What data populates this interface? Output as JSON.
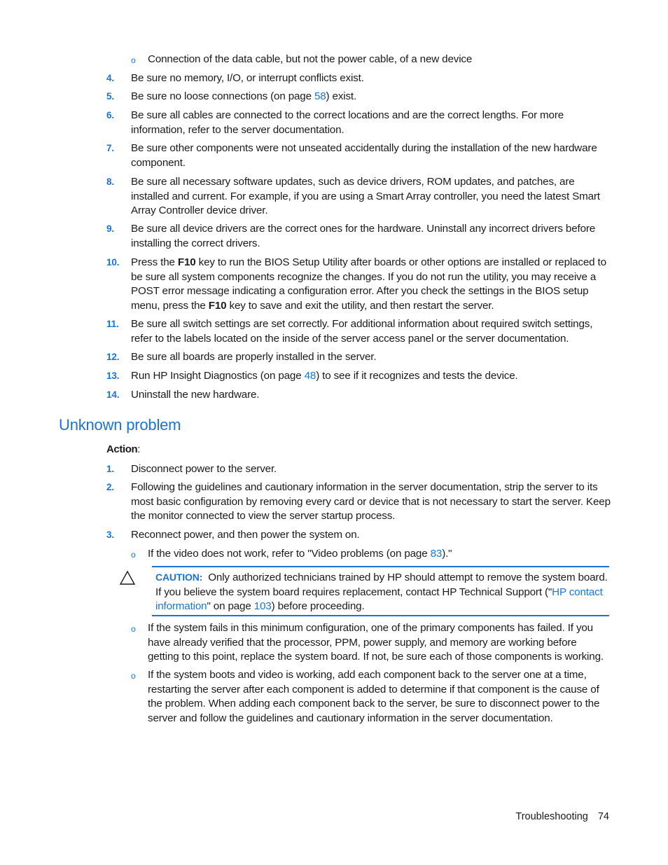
{
  "top_sub_bullet": "Connection of the data cable, but not the power cable, of a new device",
  "steps_part1": [
    {
      "num": "4.",
      "text": "Be sure no memory, I/O, or interrupt conflicts exist."
    },
    {
      "num": "5.",
      "pre": "Be sure no loose connections (on page ",
      "link": "58",
      "post": ") exist."
    },
    {
      "num": "6.",
      "text": "Be sure all cables are connected to the correct locations and are the correct lengths. For more information, refer to the server documentation."
    },
    {
      "num": "7.",
      "text": "Be sure other components were not unseated accidentally during the installation of the new hardware component."
    },
    {
      "num": "8.",
      "text": "Be sure all necessary software updates, such as device drivers, ROM updates, and patches, are installed and current. For example, if you are using a Smart Array controller, you need the latest Smart Array Controller device driver."
    },
    {
      "num": "9.",
      "text": "Be sure all device drivers are the correct ones for the hardware. Uninstall any incorrect drivers before installing the correct drivers."
    },
    {
      "num": "10.",
      "a": "Press the ",
      "key1": "F10",
      "b": " key to run the BIOS Setup Utility after boards or other options are installed or replaced to be sure all system components recognize the changes. If you do not run the utility, you may receive a POST error message indicating a configuration error. After you check the settings in the BIOS setup menu, press the ",
      "key2": "F10",
      "c": " key to save and exit the utility, and then restart the server."
    },
    {
      "num": "11.",
      "text": "Be sure all switch settings are set correctly. For additional information about required switch settings, refer to the labels located on the inside of the server access panel or the server documentation."
    },
    {
      "num": "12.",
      "text": "Be sure all boards are properly installed in the server."
    },
    {
      "num": "13.",
      "pre": "Run HP Insight Diagnostics (on page ",
      "link": "48",
      "post": ") to see if it recognizes and tests the device."
    },
    {
      "num": "14.",
      "text": "Uninstall the new hardware."
    }
  ],
  "section": {
    "heading": "Unknown problem",
    "action_label": "Action",
    "action_colon": ":",
    "steps": [
      {
        "num": "1.",
        "text": "Disconnect power to the server."
      },
      {
        "num": "2.",
        "text": "Following the guidelines and cautionary information in the server documentation, strip the server to its most basic configuration by removing every card or device that is not necessary to start the server. Keep the monitor connected to view the server startup process."
      },
      {
        "num": "3.",
        "text": "Reconnect power, and then power the system on."
      }
    ],
    "video_bullet": {
      "pre": "If the video does not work, refer to \"Video problems (on page ",
      "link": "83",
      "post": ").\""
    },
    "caution": {
      "label": "CAUTION:",
      "pre": "Only authorized technicians trained by HP should attempt to remove the system board. If you believe the system board requires replacement, contact HP Technical Support (\"",
      "link_text": "HP contact information",
      "mid": "\" on page ",
      "link_page": "103",
      "post": ") before proceeding."
    },
    "bullets": [
      "If the system fails in this minimum configuration, one of the primary components has failed. If you have already verified that the processor, PPM, power supply, and memory are working before getting to this point, replace the system board. If not, be sure each of those components is working.",
      "If the system boots and video is working, add each component back to the server one at a time, restarting the server after each component is added to determine if that component is the cause of the problem. When adding each component back to the server, be sure to disconnect power to the server and follow the guidelines and cautionary information in the server documentation."
    ]
  },
  "footer": {
    "section": "Troubleshooting",
    "page": "74"
  },
  "colors": {
    "accent": "#1a73d9",
    "text": "#1a1a1a"
  }
}
